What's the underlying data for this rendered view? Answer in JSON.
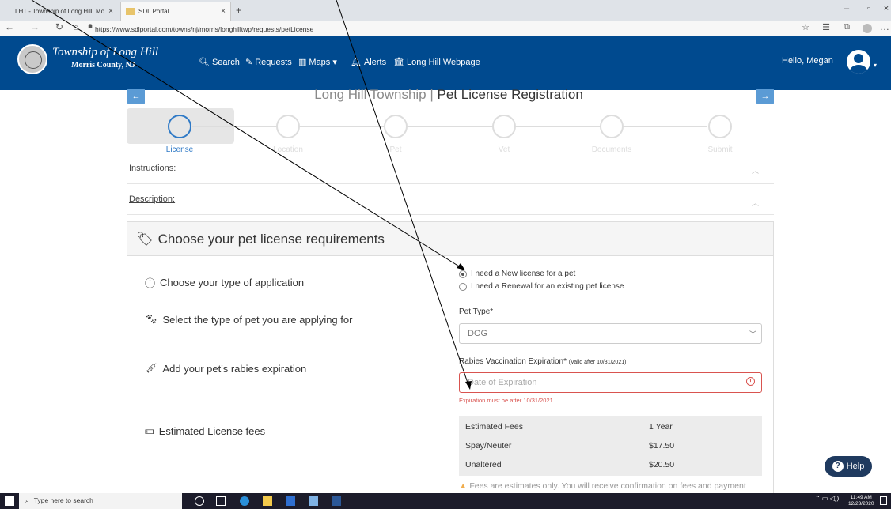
{
  "browser": {
    "tabs": [
      {
        "label": "LHT - Township of Long Hill, Mo",
        "close": "×"
      },
      {
        "label": "SDL Portal",
        "close": "×"
      }
    ],
    "new_tab": "+",
    "url": "https://www.sdlportal.com/towns/nj/morris/longhilltwp/requests/petLicense"
  },
  "header": {
    "brand_name": "Township of Long Hill",
    "brand_sub": "Morris County, NJ",
    "nav": [
      "Search",
      "Requests",
      "Maps",
      "Alerts",
      "Long Hill Webpage"
    ],
    "greeting": "Hello, Megan"
  },
  "page": {
    "title_muted": "Long Hill Township | ",
    "title_main": "Pet License Registration"
  },
  "steps": [
    {
      "label": "License",
      "active": true
    },
    {
      "label": "Location",
      "active": false
    },
    {
      "label": "Pet",
      "active": false
    },
    {
      "label": "Vet",
      "active": false
    },
    {
      "label": "Documents",
      "active": false
    },
    {
      "label": "Submit",
      "active": false
    }
  ],
  "accordions": {
    "instructions": "Instructions:",
    "description": "Description:"
  },
  "panel": {
    "title": "Choose your pet license requirements",
    "application_label": "Choose your type of application",
    "radio_new": "I need a New license for a pet",
    "radio_renewal": "I need a Renewal for an existing pet license",
    "pet_row_label": "Select the type of pet you are applying for",
    "pet_type_label": "Pet Type*",
    "pet_type_value": "DOG",
    "rabies_row_label": "Add your pet's rabies expiration",
    "rabies_label": "Rabies Vaccination Expiration*",
    "rabies_hint": "(Valid after 10/31/2021)",
    "rabies_placeholder": "Date of Expiration",
    "rabies_error": "Expiration must be after 10/31/2021",
    "fees_row_label": "Estimated License fees",
    "fees": {
      "headers": [
        "Estimated Fees",
        "1 Year"
      ],
      "rows": [
        [
          "Spay/Neuter",
          "$17.50"
        ],
        [
          "Unaltered",
          "$20.50"
        ]
      ]
    },
    "fees_note": "Fees are estimates only. You will receive confirmation on fees and payment"
  },
  "help_label": "Help",
  "taskbar": {
    "search_placeholder": "Type here to search",
    "time": "11:49 AM",
    "date": "12/23/2020"
  },
  "colors": {
    "header_bg": "#004a8f",
    "accent": "#2e79c6",
    "error": "#d9534f"
  }
}
